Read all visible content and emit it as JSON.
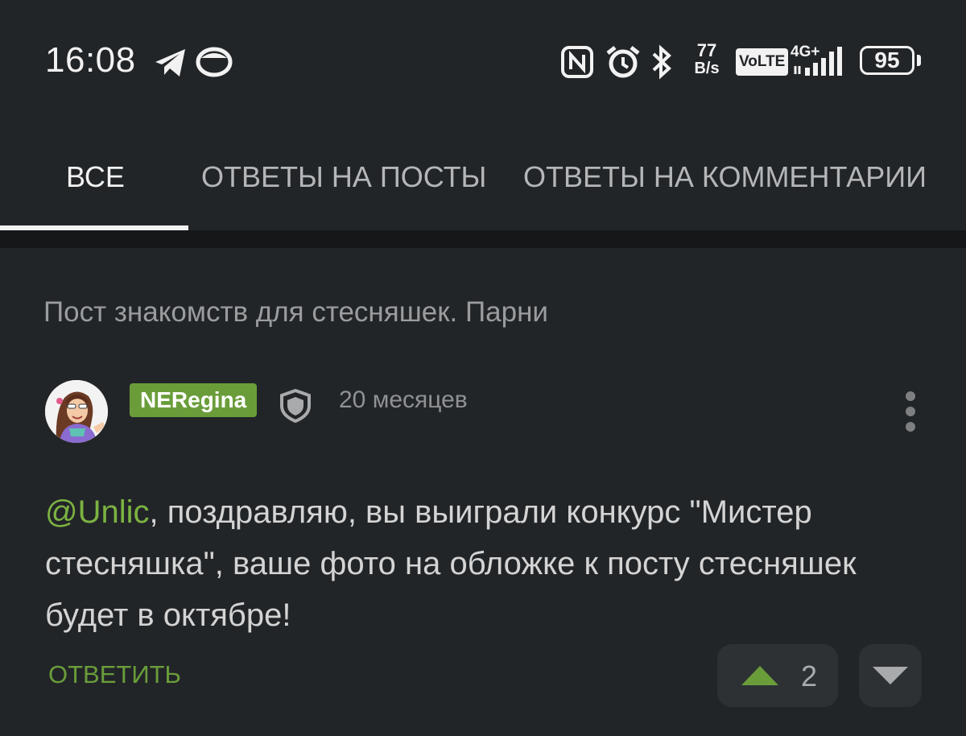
{
  "status_bar": {
    "time": "16:08",
    "net_speed_value": "77",
    "net_speed_unit": "B/s",
    "volte": "VoLTE",
    "network": "4G+",
    "battery": "95",
    "icons": [
      "telegram-icon",
      "notification-app-icon",
      "nfc-icon",
      "alarm-icon",
      "bluetooth-icon",
      "signal-icon",
      "battery-icon"
    ]
  },
  "tabs": [
    {
      "label": "ВСЕ",
      "active": true
    },
    {
      "label": "ОТВЕТЫ НА ПОСТЫ",
      "active": false
    },
    {
      "label": "ОТВЕТЫ НА КОММЕНТАРИИ",
      "active": false
    }
  ],
  "post": {
    "title": "Пост знакомств для стесняшек. Парни"
  },
  "comment": {
    "author": "NERegina",
    "age": "20 месяцев",
    "mention": "@Unlic",
    "text": ", поздравляю, вы выиграли конкурс \"Мистер стесняшка\", ваше фото на обложке к посту стесняшек будет в октябре!",
    "reply_label": "ОТВЕТИТЬ",
    "rating": "2"
  },
  "colors": {
    "background": "#222528",
    "accent_green": "#6a9d3a",
    "mention_green": "#7cb342",
    "vote_button": "#2d3134"
  }
}
